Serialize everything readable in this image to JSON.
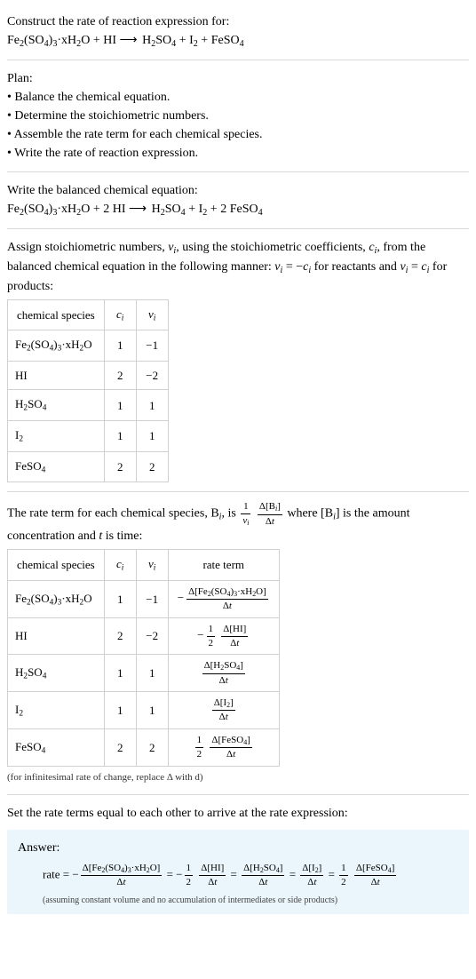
{
  "intro": {
    "heading": "Construct the rate of reaction expression for:",
    "equation_html": "Fe<sub>2</sub>(SO<sub>4</sub>)<sub>3</sub>·xH<sub>2</sub>O + HI  <span class=\"arrow\">⟶</span>  H<sub>2</sub>SO<sub>4</sub> + I<sub>2</sub> + FeSO<sub>4</sub>"
  },
  "plan": {
    "heading": "Plan:",
    "b1": "• Balance the chemical equation.",
    "b2": "• Determine the stoichiometric numbers.",
    "b3": "• Assemble the rate term for each chemical species.",
    "b4": "• Write the rate of reaction expression."
  },
  "balanced": {
    "heading": "Write the balanced chemical equation:",
    "equation_html": "Fe<sub>2</sub>(SO<sub>4</sub>)<sub>3</sub>·xH<sub>2</sub>O + 2 HI  <span class=\"arrow\">⟶</span>  H<sub>2</sub>SO<sub>4</sub> + I<sub>2</sub> + 2 FeSO<sub>4</sub>"
  },
  "stoich": {
    "intro_html": "Assign stoichiometric numbers, <i>ν<sub>i</sub></i>, using the stoichiometric coefficients, <i>c<sub>i</sub></i>, from the balanced chemical equation in the following manner: <i>ν<sub>i</sub></i> = −<i>c<sub>i</sub></i> for reactants and <i>ν<sub>i</sub></i> = <i>c<sub>i</sub></i> for products:",
    "h1": "chemical species",
    "h2_html": "<i>c<sub>i</sub></i>",
    "h3_html": "<i>ν<sub>i</sub></i>",
    "rows": [
      {
        "sp_html": "Fe<sub>2</sub>(SO<sub>4</sub>)<sub>3</sub>·xH<sub>2</sub>O",
        "c": "1",
        "v": "−1"
      },
      {
        "sp_html": "HI",
        "c": "2",
        "v": "−2"
      },
      {
        "sp_html": "H<sub>2</sub>SO<sub>4</sub>",
        "c": "1",
        "v": "1"
      },
      {
        "sp_html": "I<sub>2</sub>",
        "c": "1",
        "v": "1"
      },
      {
        "sp_html": "FeSO<sub>4</sub>",
        "c": "2",
        "v": "2"
      }
    ]
  },
  "rateterm": {
    "intro_html": "The rate term for each chemical species, B<sub><i>i</i></sub>, is <span class=\"frac\"><span class=\"num\">1</span><span class=\"den\"><i>ν<sub>i</sub></i></span></span> <span class=\"frac\"><span class=\"num\">Δ[B<sub><i>i</i></sub>]</span><span class=\"den\">Δ<i>t</i></span></span> where [B<sub><i>i</i></sub>] is the amount concentration and <i>t</i> is time:",
    "h1": "chemical species",
    "h2_html": "<i>c<sub>i</sub></i>",
    "h3_html": "<i>ν<sub>i</sub></i>",
    "h4": "rate term",
    "rows": [
      {
        "sp_html": "Fe<sub>2</sub>(SO<sub>4</sub>)<sub>3</sub>·xH<sub>2</sub>O",
        "c": "1",
        "v": "−1",
        "term_html": "<span class=\"neg\">−</span><span class=\"frac\"><span class=\"num\">Δ[Fe<sub>2</sub>(SO<sub>4</sub>)<sub>3</sub>·xH<sub>2</sub>O]</span><span class=\"den\">Δ<i>t</i></span></span>"
      },
      {
        "sp_html": "HI",
        "c": "2",
        "v": "−2",
        "term_html": "<span class=\"neg\">−</span><span class=\"frac\"><span class=\"num\">1</span><span class=\"den\">2</span></span> <span class=\"frac\"><span class=\"num\">Δ[HI]</span><span class=\"den\">Δ<i>t</i></span></span>"
      },
      {
        "sp_html": "H<sub>2</sub>SO<sub>4</sub>",
        "c": "1",
        "v": "1",
        "term_html": "<span class=\"frac\"><span class=\"num\">Δ[H<sub>2</sub>SO<sub>4</sub>]</span><span class=\"den\">Δ<i>t</i></span></span>"
      },
      {
        "sp_html": "I<sub>2</sub>",
        "c": "1",
        "v": "1",
        "term_html": "<span class=\"frac\"><span class=\"num\">Δ[I<sub>2</sub>]</span><span class=\"den\">Δ<i>t</i></span></span>"
      },
      {
        "sp_html": "FeSO<sub>4</sub>",
        "c": "2",
        "v": "2",
        "term_html": "<span class=\"frac\"><span class=\"num\">1</span><span class=\"den\">2</span></span> <span class=\"frac\"><span class=\"num\">Δ[FeSO<sub>4</sub>]</span><span class=\"den\">Δ<i>t</i></span></span>"
      }
    ],
    "note": "(for infinitesimal rate of change, replace Δ with d)"
  },
  "final": {
    "intro": "Set the rate terms equal to each other to arrive at the rate expression:",
    "answer_label": "Answer:",
    "rate_html": "rate = −<span class=\"frac\"><span class=\"num\">Δ[Fe<sub>2</sub>(SO<sub>4</sub>)<sub>3</sub>·xH<sub>2</sub>O]</span><span class=\"den\">Δ<i>t</i></span></span> = −<span class=\"frac\"><span class=\"num\">1</span><span class=\"den\">2</span></span> <span class=\"frac\"><span class=\"num\">Δ[HI]</span><span class=\"den\">Δ<i>t</i></span></span> = <span class=\"frac\"><span class=\"num\">Δ[H<sub>2</sub>SO<sub>4</sub>]</span><span class=\"den\">Δ<i>t</i></span></span> = <span class=\"frac\"><span class=\"num\">Δ[I<sub>2</sub>]</span><span class=\"den\">Δ<i>t</i></span></span> = <span class=\"frac\"><span class=\"num\">1</span><span class=\"den\">2</span></span> <span class=\"frac\"><span class=\"num\">Δ[FeSO<sub>4</sub>]</span><span class=\"den\">Δ<i>t</i></span></span>",
    "note": "(assuming constant volume and no accumulation of intermediates or side products)"
  }
}
